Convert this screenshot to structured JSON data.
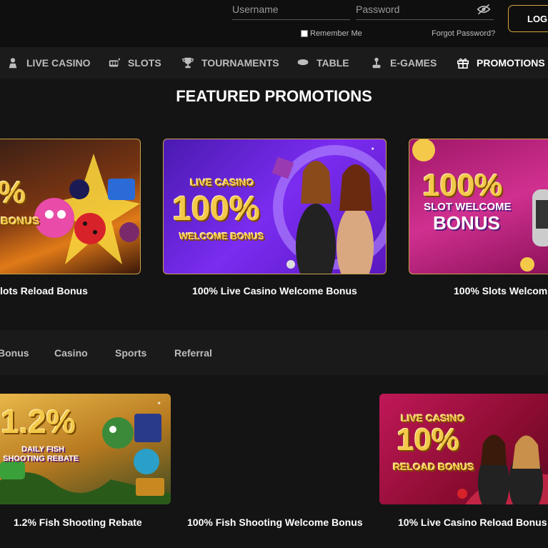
{
  "login": {
    "username_placeholder": "Username",
    "password_placeholder": "Password",
    "remember_label": "Remember Me",
    "forgot_label": "Forgot Password?",
    "login_label": "LOGI"
  },
  "nav": {
    "items": [
      {
        "label": "LIVE CASINO",
        "icon": "live-casino-icon"
      },
      {
        "label": "SLOTS",
        "icon": "slots-icon"
      },
      {
        "label": "TOURNAMENTS",
        "icon": "trophy-icon"
      },
      {
        "label": "TABLE",
        "icon": "table-icon"
      },
      {
        "label": "E-GAMES",
        "icon": "joystick-icon"
      },
      {
        "label": "PROMOTIONS",
        "icon": "gift-icon",
        "active": true
      }
    ]
  },
  "featured": {
    "title": "FEATURED PROMOTIONS",
    "cards": [
      {
        "caption": "lots Reload Bonus",
        "banner_text": [
          "%",
          "BONUS"
        ]
      },
      {
        "caption": "100% Live Casino Welcome Bonus",
        "banner_text": [
          "LIVE CASINO",
          "100%",
          "WELCOME BONUS"
        ]
      },
      {
        "caption": "100% Slots Welcom",
        "banner_text": [
          "100%",
          "SLOT WELCOME",
          "BONUS"
        ]
      }
    ]
  },
  "filters": {
    "items": [
      "Bonus",
      "Casino",
      "Sports",
      "Referral"
    ]
  },
  "promos": {
    "cards": [
      {
        "caption": "1.2% Fish Shooting Rebate",
        "banner_text": [
          "1.2%",
          "DAILY FISH",
          "SHOOTING REBATE"
        ]
      },
      {
        "caption": "100% Fish Shooting Welcome Bonus"
      },
      {
        "caption": "10% Live Casino Reload Bonus",
        "banner_text": [
          "LIVE CASINO",
          "10%",
          "RELOAD BONUS"
        ]
      }
    ]
  },
  "colors": {
    "accent_gold": "#d4a640",
    "bg": "#141414",
    "nav_bg": "#1b1b1b"
  }
}
